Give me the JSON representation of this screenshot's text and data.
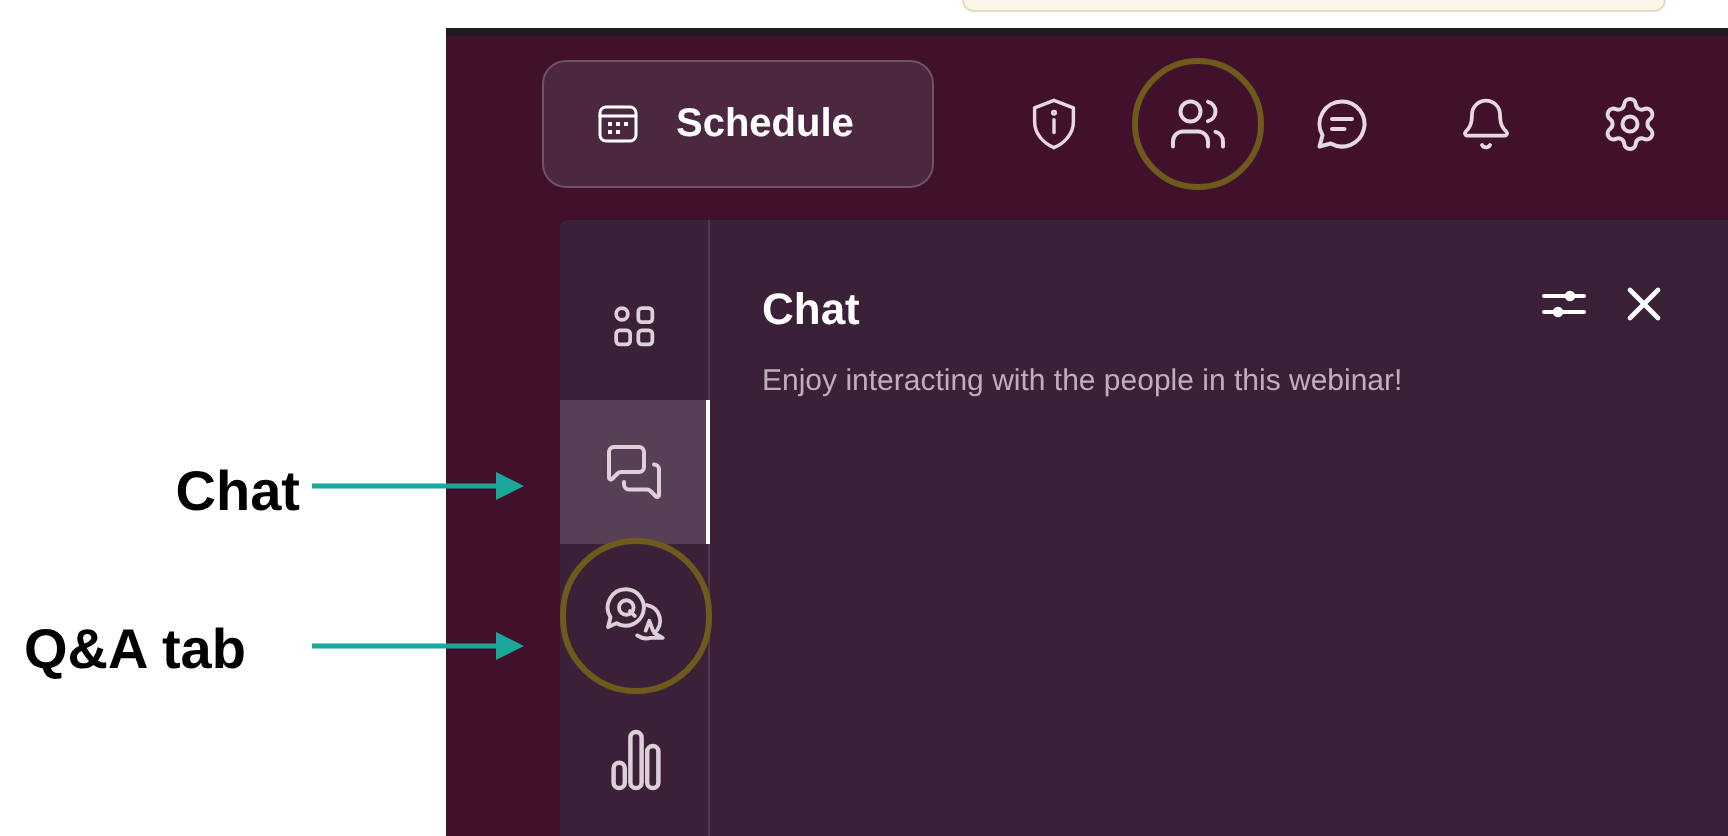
{
  "annotations": [
    {
      "label": "Chat"
    },
    {
      "label": "Q&A tab"
    }
  ],
  "toolbar": {
    "schedule_button": {
      "label": "Schedule"
    },
    "icons": [
      {
        "kind": "info",
        "circled": false
      },
      {
        "kind": "people",
        "circled": true
      },
      {
        "kind": "chat",
        "circled": false
      },
      {
        "kind": "bell",
        "circled": false
      },
      {
        "kind": "settings",
        "circled": false
      }
    ]
  },
  "panel": {
    "tabs": [
      {
        "kind": "apps",
        "selected": false,
        "circled": false
      },
      {
        "kind": "chat",
        "selected": true,
        "circled": false
      },
      {
        "kind": "qa",
        "selected": false,
        "circled": true
      },
      {
        "kind": "polls",
        "selected": false,
        "circled": false
      }
    ],
    "title": "Chat",
    "description": "Enjoy interacting with the people in this webinar!"
  }
}
